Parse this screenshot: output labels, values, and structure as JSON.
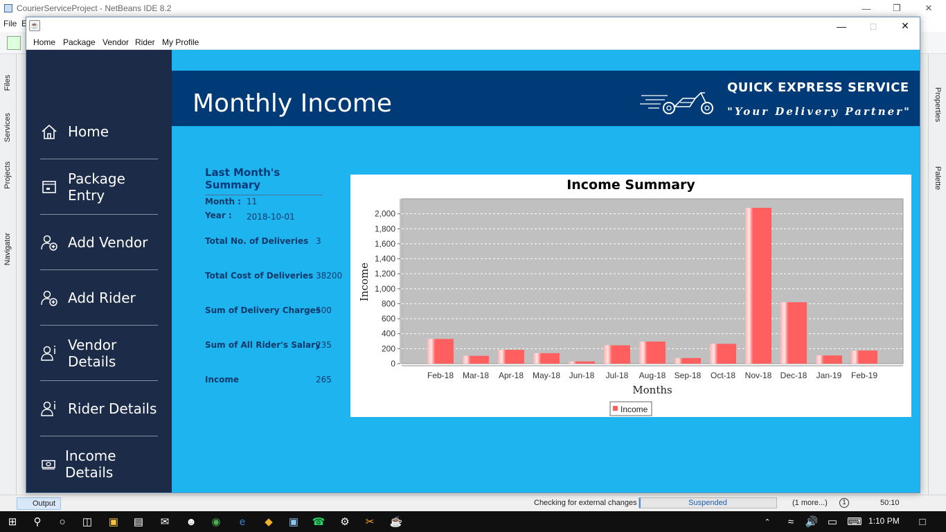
{
  "ide": {
    "title": "CourierServiceProject - NetBeans IDE 8.2",
    "menu": [
      "File",
      "E"
    ],
    "left_tabs": [
      "Files",
      "Services",
      "Projects",
      "Navigator"
    ],
    "right_tabs": [
      "Properties",
      "Palette"
    ],
    "output_tab": "Output",
    "status_text": "Checking for external changes",
    "progress_label": "Suspended",
    "more_label": "(1 more...)",
    "notif_count": "1",
    "position": "50:10"
  },
  "app": {
    "menu": [
      "Home",
      "Package",
      "Vendor",
      "Rider",
      "My Profile"
    ],
    "sidebar": [
      {
        "label": "Home",
        "icon": "home-icon"
      },
      {
        "label": "Package Entry",
        "icon": "package-icon"
      },
      {
        "label": "Add Vendor",
        "icon": "add-user-icon"
      },
      {
        "label": "Add Rider",
        "icon": "add-user-icon"
      },
      {
        "label": "Vendor Details",
        "icon": "user-info-icon"
      },
      {
        "label": "Rider Details",
        "icon": "user-info-icon"
      },
      {
        "label": "Income Details",
        "icon": "money-icon"
      }
    ],
    "page_title": "Monthly Income",
    "brand_name": "QUICK EXPRESS SERVICE",
    "brand_tagline": "\"Your Delivery Partner\""
  },
  "summary": {
    "heading": "Last Month's Summary",
    "month_label": "Month :",
    "month_value": "11",
    "year_label": "Year :",
    "year_value": "2018-10-01",
    "deliveries_label": "Total No. of Deliveries",
    "deliveries_value": "3",
    "cost_label": "Total Cost of Deliveries",
    "cost_value": "38200",
    "charges_label": "Sum of Delivery Charges",
    "charges_value": "500",
    "salary_label": "Sum of All Rider's Salary",
    "salary_value": "235",
    "income_label": "Income",
    "income_value": "265"
  },
  "taskbar": {
    "time": "1:10 PM"
  },
  "colors": {
    "sidebar_bg": "#1b2b48",
    "main_bg": "#1eb4f0",
    "banner_bg": "#003b78",
    "bar": "#ff5f5f",
    "plot_bg": "#c0c0c0"
  },
  "chart_data": {
    "type": "bar",
    "title": "Income Summary",
    "xlabel": "Months",
    "ylabel": "Income",
    "categories": [
      "Feb-18",
      "Mar-18",
      "Apr-18",
      "May-18",
      "Jun-18",
      "Jul-18",
      "Aug-18",
      "Sep-18",
      "Oct-18",
      "Nov-18",
      "Dec-18",
      "Jan-19",
      "Feb-19"
    ],
    "series": [
      {
        "name": "Income",
        "values": [
          330,
          105,
          185,
          140,
          30,
          245,
          295,
          75,
          265,
          2080,
          820,
          110,
          175
        ]
      }
    ],
    "ylim": [
      0,
      2200
    ],
    "yticks": [
      0,
      200,
      400,
      600,
      800,
      1000,
      1200,
      1400,
      1600,
      1800,
      2000
    ],
    "ytick_labels": [
      "0",
      "200",
      "400",
      "600",
      "800",
      "1,000",
      "1,200",
      "1,400",
      "1,600",
      "1,800",
      "2,000"
    ],
    "grid": true,
    "legend": "bottom-center"
  }
}
